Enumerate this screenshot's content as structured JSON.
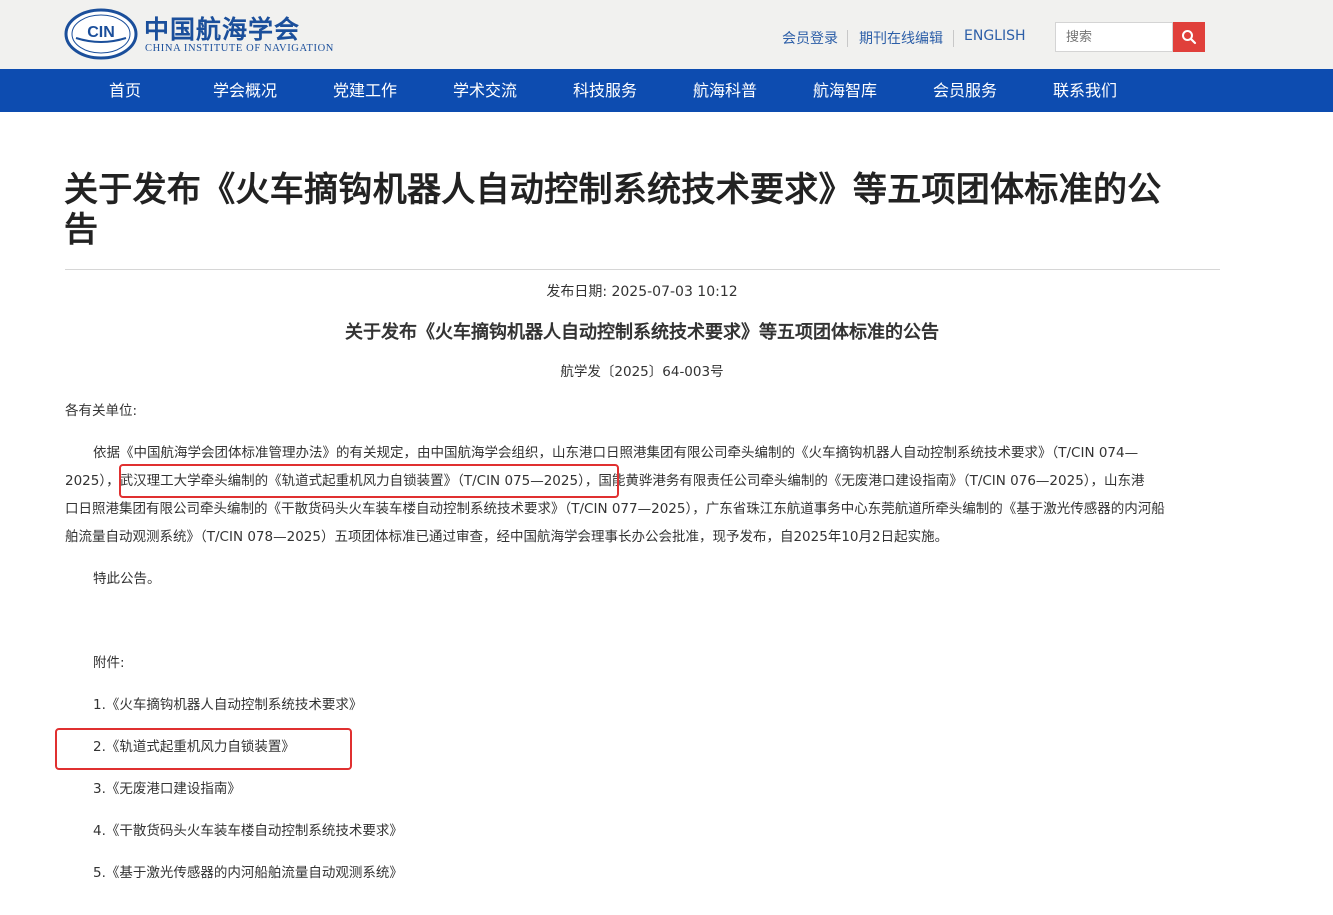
{
  "header": {
    "logo_cn": "中国航海学会",
    "logo_en": "CHINA INSTITUTE OF NAVIGATION",
    "logo_emblem_text": "CIN",
    "links": [
      "会员登录",
      "期刊在线编辑",
      "ENGLISH"
    ],
    "search_placeholder": "搜索",
    "search_icon": "search-icon"
  },
  "nav": {
    "items": [
      "首页",
      "学会概况",
      "党建工作",
      "学术交流",
      "科技服务",
      "航海科普",
      "航海智库",
      "会员服务",
      "联系我们"
    ]
  },
  "article": {
    "title_line1": "关于发布《火车摘钩机器人自动控制系统技术要求》等五项团体标准的公",
    "title_line2": "告",
    "date": "发布日期: 2025-07-03 10:12",
    "doc_title": "关于发布《火车摘钩机器人自动控制系统技术要求》等五项团体标准的公告",
    "doc_number": "航学发〔2025〕64-003号",
    "salutation": "各有关单位:",
    "body_lines": [
      "依据《中国航海学会团体标准管理办法》的有关规定，由中国航海学会组织，山东港口日照港集团有限公司牵头编制的《火车摘钩机器人自动控制系统技术要求》（T/CIN 074—",
      "2025），武汉理工大学牵头编制的《轨道式起重机风力自锁装置》（T/CIN 075—2025），国能黄骅港务有限责任公司牵头编制的《无废港口建设指南》（T/CIN 076—2025），山东港",
      "口日照港集团有限公司牵头编制的《干散货码头火车装车楼自动控制系统技术要求》（T/CIN 077—2025），广东省珠江东航道事务中心东莞航道所牵头编制的《基于激光传感器的内河船",
      "舶流量自动观测系统》（T/CIN 078—2025）五项团体标准已通过审查，经中国航海学会理事长办公会批准，现予发布，自2025年10月2日起实施。"
    ],
    "closing": "特此公告。",
    "attachments_label": "附件:",
    "attachments": [
      "1.《火车摘钩机器人自动控制系统技术要求》",
      "2.《轨道式起重机风力自锁装置》",
      "3.《无废港口建设指南》",
      "4.《干散货码头火车装车楼自动控制系统技术要求》",
      "5.《基于激光传感器的内河船舶流量自动观测系统》"
    ]
  },
  "colors": {
    "nav_bg": "#0d4cb0",
    "topbar_bg": "#f1f1ef",
    "brand_blue": "#1b4f9b",
    "search_btn": "#e0403b",
    "highlight_red": "#e03030"
  }
}
